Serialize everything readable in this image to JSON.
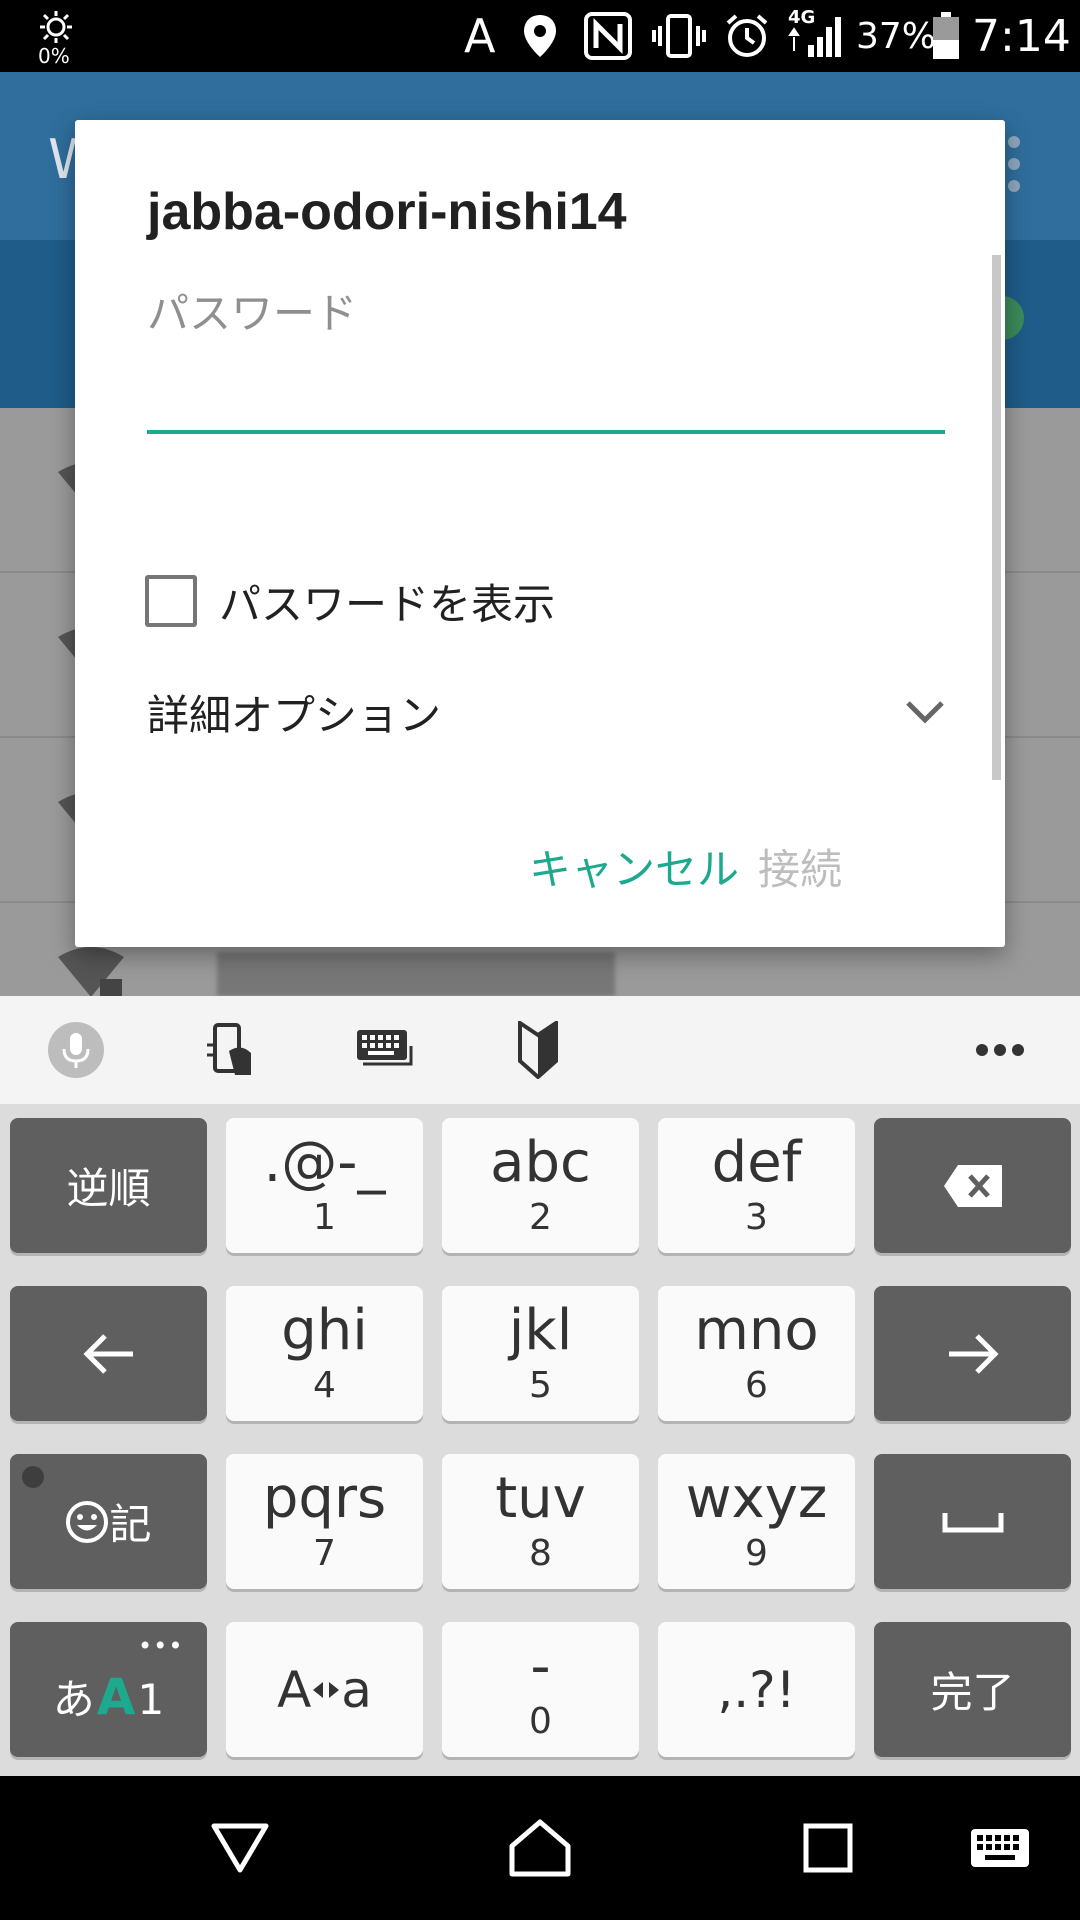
{
  "status_bar": {
    "brightness_level": "0%",
    "notification_letter": "A",
    "network_type": "4G",
    "battery_percent": "37%",
    "time": "7:14"
  },
  "background_app": {
    "title_fragment": "W"
  },
  "dialog": {
    "title": "jabba-odori-nishi14",
    "password_label": "パスワード",
    "password_value": "",
    "show_password_label": "パスワードを表示",
    "show_password_checked": false,
    "advanced_options_label": "詳細オプション",
    "cancel_label": "キャンセル",
    "connect_label": "接続",
    "accent_color": "#1ca98e",
    "disabled_color": "#bdbdbd"
  },
  "keyboard": {
    "toolbar": [
      "mic-icon",
      "phone-hand-icon",
      "keyboard-icon",
      "beginner-mark-icon",
      "more-icon"
    ],
    "keys": {
      "reverse": "逆順",
      "k1_main": ".@-_",
      "k1_sub": "1",
      "k2_main": "abc",
      "k2_sub": "2",
      "k3_main": "def",
      "k3_sub": "3",
      "k4_main": "ghi",
      "k4_sub": "4",
      "k5_main": "jkl",
      "k5_sub": "5",
      "k6_main": "mno",
      "k6_sub": "6",
      "k7_main": "pqrs",
      "k7_sub": "7",
      "k8_main": "tuv",
      "k8_sub": "8",
      "k9_main": "wxyz",
      "k9_sub": "9",
      "emoji_label": "記",
      "mode_hira": "あ",
      "mode_alpha": "A",
      "mode_num": "1",
      "case_label_a": "A",
      "case_label_b": "a",
      "k0_main": "-",
      "k0_sub": "0",
      "punct": ",.?!",
      "done": "完了"
    }
  },
  "nav_bar": [
    "back-icon",
    "home-icon",
    "recents-icon",
    "keyboard-switch-icon"
  ]
}
